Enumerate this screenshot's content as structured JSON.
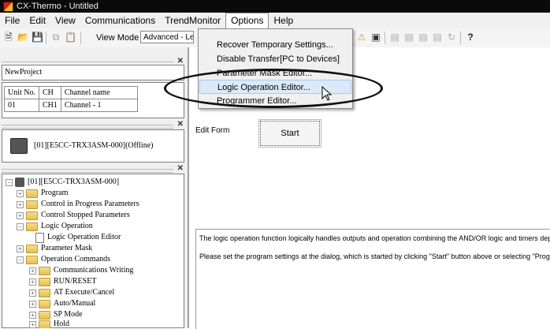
{
  "window": {
    "title": "CX-Thermo - Untitled"
  },
  "menubar": {
    "items": [
      "File",
      "Edit",
      "View",
      "Communications",
      "TrendMonitor",
      "Options",
      "Help"
    ]
  },
  "toolbar": {
    "view_mode_label": "View Mode :",
    "view_mode_value": "Advanced - Leve"
  },
  "options_menu": {
    "items": [
      "Recover Temporary Settings...",
      "Disable Transfer[PC to Devices]",
      "Parameter Mask Editor...",
      "Logic Operation Editor...",
      "Programmer Editor..."
    ],
    "highlighted": "Logic Operation Editor..."
  },
  "project_panel": {
    "project_name": "NewProject",
    "table": {
      "headers": [
        "Unit No.",
        "CH",
        "Channel name"
      ],
      "rows": [
        [
          "01",
          "CH1",
          "Channel - 1"
        ]
      ]
    }
  },
  "device_panel": {
    "device_label": "[01][E5CC-TRX3ASM-000](Offline)"
  },
  "tree": {
    "root": "[01][E5CC-TRX3ASM-000]",
    "items": [
      "Program",
      "Control in Progress Parameters",
      "Control Stopped Parameters",
      "Logic Operation",
      "Logic Operation Editor",
      "Parameter Mask",
      "Operation Commands",
      "Communications Writing",
      "RUN/RESET",
      "AT Execute/Cancel",
      "Auto/Manual",
      "SP Mode",
      "Hold"
    ]
  },
  "edit_form": {
    "label": "Edit Form",
    "start_button": "Start"
  },
  "messages": {
    "line1": "The logic operation function logically handles outputs and operation combining the AND/OR logic and timers depending",
    "line2": "Please set the program settings at the dialog, which is started by clicking \"Start\" button above or selecting \"Programmer"
  },
  "colors": {
    "titlebar": "#0a0a0a",
    "menu_highlight": "#dce9f8",
    "folder": "#e8bf4f"
  }
}
